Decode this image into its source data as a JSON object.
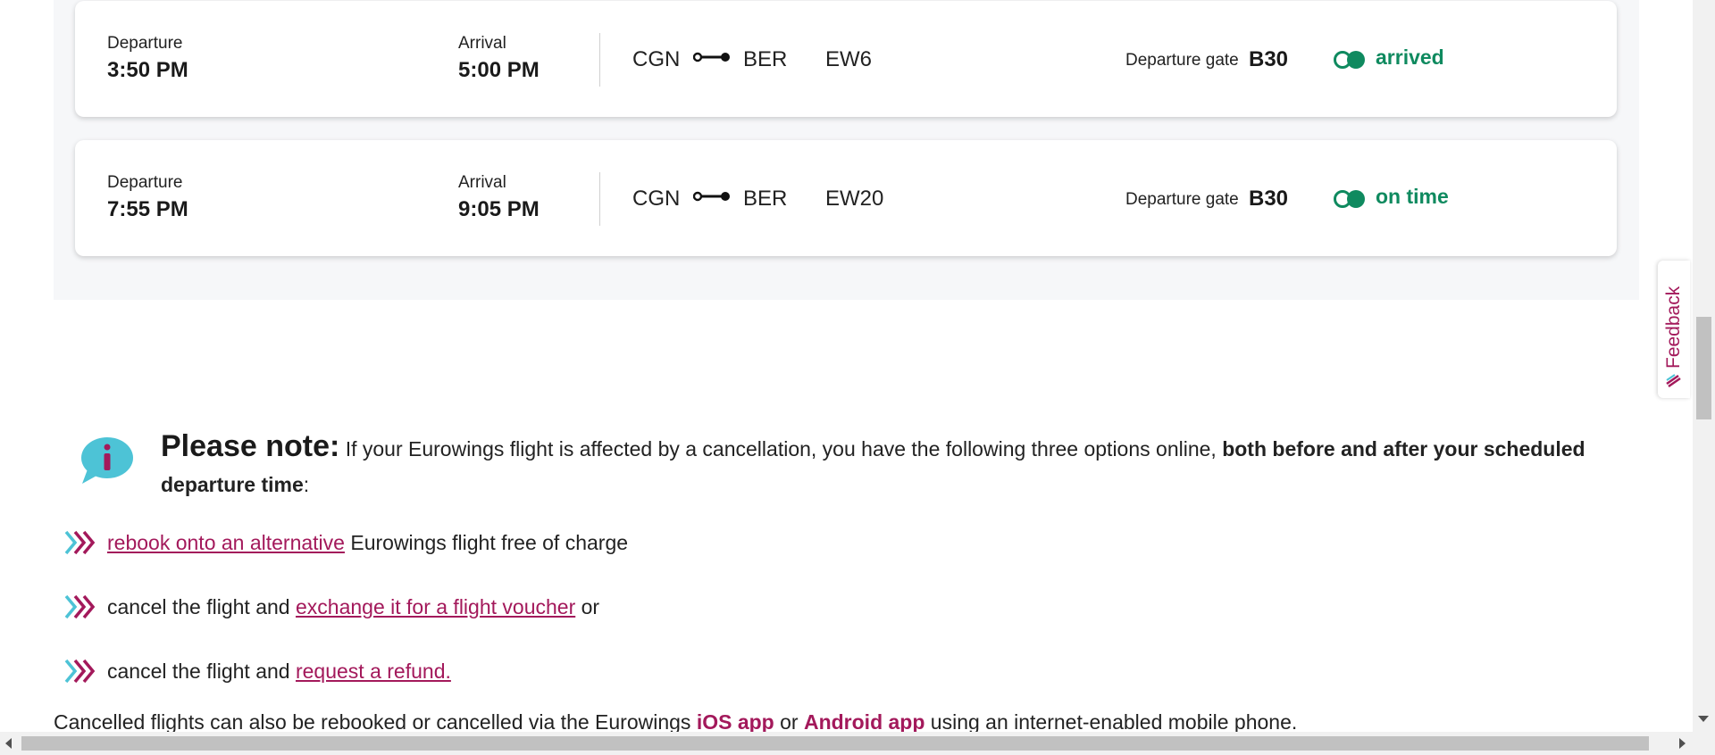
{
  "flights": [
    {
      "departure_label": "Departure",
      "departure_time": "3:50 PM",
      "arrival_label": "Arrival",
      "arrival_time": "5:00 PM",
      "origin": "CGN",
      "destination": "BER",
      "flight_number": "EW6",
      "gate_label": "Departure gate",
      "gate": "B30",
      "status": "arrived"
    },
    {
      "departure_label": "Departure",
      "departure_time": "7:55 PM",
      "arrival_label": "Arrival",
      "arrival_time": "9:05 PM",
      "origin": "CGN",
      "destination": "BER",
      "flight_number": "EW20",
      "gate_label": "Departure gate",
      "gate": "B30",
      "status": "on time"
    }
  ],
  "note": {
    "title": "Please note:",
    "text": " If your Eurowings flight is affected by a cancellation, you have the following three options online, ",
    "bold": "both before and after your scheduled departure time",
    "end": ":"
  },
  "options": [
    {
      "pre": "",
      "link": "rebook onto an alternative",
      "post": " Eurowings flight free of charge"
    },
    {
      "pre": "cancel the flight and ",
      "link": "exchange it for a flight voucher",
      "post": " or"
    },
    {
      "pre": "cancel the flight and ",
      "link": "request a refund.",
      "post": ""
    }
  ],
  "footer": {
    "pre": "Cancelled flights can also be rebooked or cancelled via the Eurowings ",
    "ios": "iOS app",
    "mid": " or ",
    "android": "Android app",
    "post": " using an internet-enabled mobile phone."
  },
  "feedback_label": "Feedback",
  "colors": {
    "status_green": "#0f8a5f",
    "brand_magenta": "#a3195b",
    "info_cyan": "#4dc3d6"
  }
}
